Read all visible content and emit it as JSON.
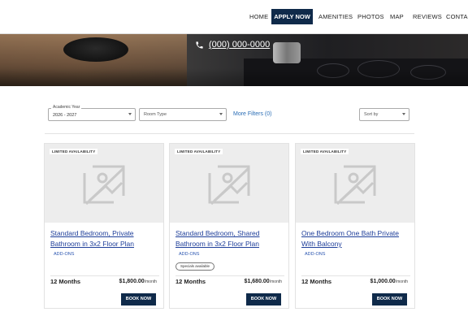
{
  "nav": {
    "items": [
      "HOME",
      "APPLY NOW",
      "AMENITIES",
      "PHOTOS",
      "MAP",
      "REVIEWS",
      "CONTAC"
    ]
  },
  "hero": {
    "phone": "(000) 000-0000"
  },
  "filters": {
    "academic_year_label": "Academic Year",
    "academic_year_value": "2026 - 2027",
    "room_type_placeholder": "Room Type",
    "more_filters": "More Filters (0)",
    "sort_by": "Sort by"
  },
  "cards": [
    {
      "badge": "LIMITED AVAILABILITY",
      "title": "Standard Bedroom, Private Bathroom in 3x2 Floor Plan",
      "addons": "ADD-ONS",
      "specials": "",
      "term": "12 Months",
      "price": "$1,800.00",
      "per": "/month",
      "book": "BOOK NOW"
    },
    {
      "badge": "LIMITED AVAILABILITY",
      "title": "Standard Bedroom, Shared Bathroom in 3x2 Floor Plan",
      "addons": "ADD-ONS",
      "specials": "Specials available",
      "term": "12 Months",
      "price": "$1,680.00",
      "per": "/month",
      "book": "BOOK NOW"
    },
    {
      "badge": "LIMITED AVAILABILITY",
      "title": "One Bedroom One Bath Private With Balcony",
      "addons": "ADD-ONS",
      "specials": "",
      "term": "12 Months",
      "price": "$1,000.00",
      "per": "/month",
      "book": "BOOK NOW"
    }
  ],
  "colors": {
    "navy": "#0f2a4a",
    "link": "#1f3f9a"
  }
}
